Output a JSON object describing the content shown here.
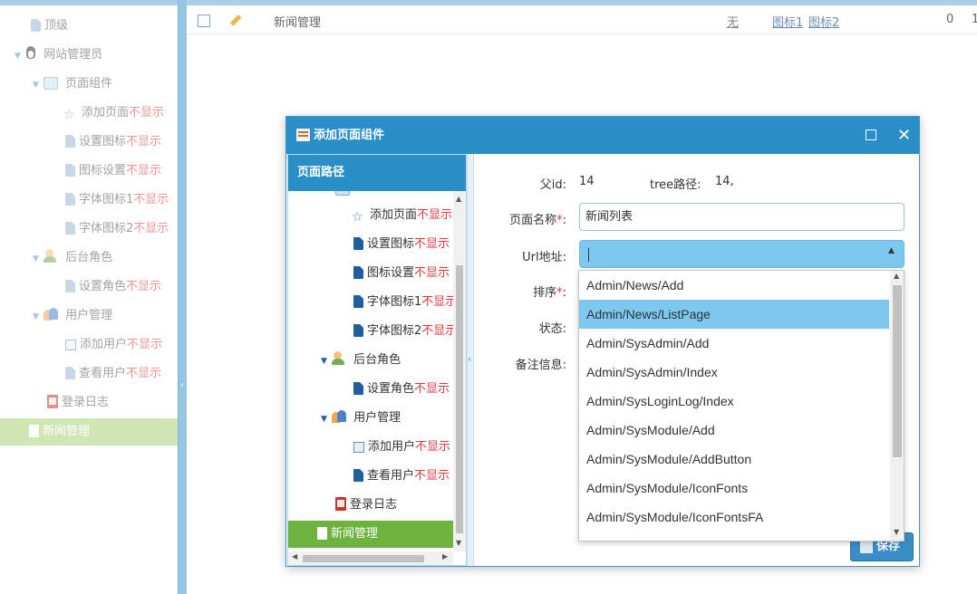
{
  "background": {
    "left_tree": [
      {
        "icon": "page-icon",
        "label": "顶级",
        "suffix": ""
      },
      {
        "icon": "tux-icon",
        "label": "网站管理员",
        "suffix": ""
      },
      {
        "icon": "component-icon",
        "label": "页面组件",
        "suffix": ""
      },
      {
        "icon": "star-icon",
        "label": "添加页面",
        "suffix": "不显示"
      },
      {
        "icon": "page-icon",
        "label": "设置图标",
        "suffix": "不显示"
      },
      {
        "icon": "page-icon",
        "label": "图标设置",
        "suffix": "不显示"
      },
      {
        "icon": "page-icon",
        "label": "字体图标1",
        "suffix": "不显示"
      },
      {
        "icon": "page-icon",
        "label": "字体图标2",
        "suffix": "不显示"
      },
      {
        "icon": "role-icon",
        "label": "后台角色",
        "suffix": ""
      },
      {
        "icon": "page-icon",
        "label": "设置角色",
        "suffix": "不显示"
      },
      {
        "icon": "users-icon",
        "label": "用户管理",
        "suffix": ""
      },
      {
        "icon": "form-icon",
        "label": "添加用户",
        "suffix": "不显示"
      },
      {
        "icon": "page-icon",
        "label": "查看用户",
        "suffix": "不显示"
      },
      {
        "icon": "log-icon",
        "label": "登录日志",
        "suffix": ""
      },
      {
        "icon": "page-icon",
        "label": "新闻管理",
        "suffix": ""
      }
    ],
    "grid_row": {
      "name": "新闻管理",
      "none": "无",
      "icon_link_1": "图标1",
      "icon_link_2": "图标2",
      "count": "0",
      "extra": "1"
    }
  },
  "dialog": {
    "title": "添加页面组件",
    "left_panel_title": "页面路径",
    "tree": [
      {
        "icon": "star-icon",
        "label": "添加页面",
        "suffix": "不显示"
      },
      {
        "icon": "page-icon",
        "label": "设置图标",
        "suffix": "不显示"
      },
      {
        "icon": "page-icon",
        "label": "图标设置",
        "suffix": "不显示"
      },
      {
        "icon": "page-icon",
        "label": "字体图标1",
        "suffix": "不显示"
      },
      {
        "icon": "page-icon",
        "label": "字体图标2",
        "suffix": "不显示"
      },
      {
        "icon": "role-icon",
        "label": "后台角色",
        "suffix": ""
      },
      {
        "icon": "page-icon",
        "label": "设置角色",
        "suffix": "不显示"
      },
      {
        "icon": "users-icon",
        "label": "用户管理",
        "suffix": ""
      },
      {
        "icon": "form-icon",
        "label": "添加用户",
        "suffix": "不显示"
      },
      {
        "icon": "page-icon",
        "label": "查看用户",
        "suffix": "不显示"
      },
      {
        "icon": "log-icon",
        "label": "登录日志",
        "suffix": ""
      },
      {
        "icon": "page-icon",
        "label": "新闻管理",
        "suffix": ""
      }
    ],
    "form": {
      "parent_id_label": "父id:",
      "parent_id_value": "14",
      "tree_path_label": "tree路径:",
      "tree_path_value": "14,",
      "page_name_label": "页面名称",
      "page_name_value": "新闻列表",
      "url_label": "Url地址:",
      "url_value": "",
      "sort_label": "排序",
      "status_label": "状态:",
      "note_label": "备注信息:",
      "required_mark": "*",
      "colon": ":"
    },
    "save_label": "保存",
    "dropdown_options": [
      "Admin/News/Add",
      "Admin/News/ListPage",
      "Admin/SysAdmin/Add",
      "Admin/SysAdmin/Index",
      "Admin/SysLoginLog/Index",
      "Admin/SysModule/Add",
      "Admin/SysModule/AddButton",
      "Admin/SysModule/IconFonts",
      "Admin/SysModule/IconFontsFA"
    ],
    "dropdown_highlighted": "Admin/News/ListPage"
  }
}
